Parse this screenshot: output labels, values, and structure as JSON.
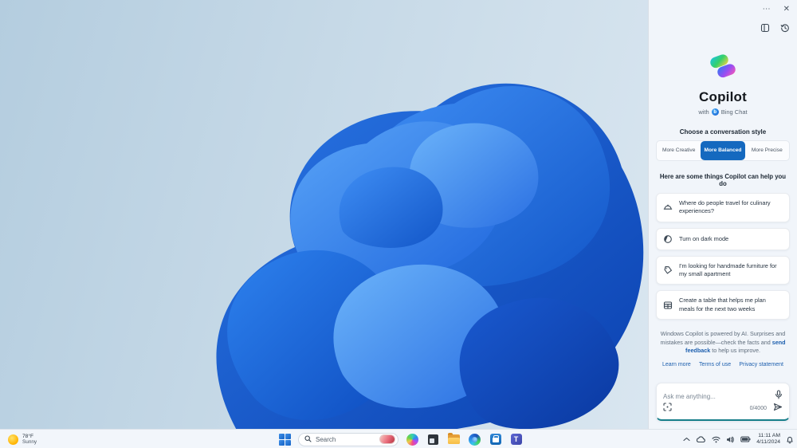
{
  "colors": {
    "accent_blue": "#1569bf",
    "link_blue": "#1d5fae",
    "input_underline_teal": "#177e8a",
    "panel_background": "#f1f5fa"
  },
  "copilot": {
    "window_controls": {
      "more": "⋯",
      "close": "✕"
    },
    "toolbar_icons": [
      "notebook-icon",
      "history-icon"
    ],
    "title": "Copilot",
    "subtitle_prefix": "with",
    "bing_badge_letter": "b",
    "subtitle_brand": "Bing Chat",
    "style_heading": "Choose a conversation style",
    "styles": [
      {
        "label": "More Creative",
        "selected": false
      },
      {
        "label": "More Balanced",
        "selected": true
      },
      {
        "label": "More Precise",
        "selected": false
      }
    ],
    "suggestions_heading": "Here are some things Copilot can help you do",
    "suggestions": [
      {
        "icon": "cloche-icon",
        "text": "Where do people travel for culinary experiences?"
      },
      {
        "icon": "dark-mode-icon",
        "text": "Turn on dark mode"
      },
      {
        "icon": "tag-icon",
        "text": "I'm looking for handmade furniture for my small apartment"
      },
      {
        "icon": "table-icon",
        "text": "Create a table that helps me plan meals for the next two weeks"
      }
    ],
    "disclaimer": {
      "part1": "Windows Copilot is powered by AI. Surprises and mistakes are possible—check the facts and ",
      "link": "send feedback",
      "part2": " to help us improve."
    },
    "footer_links": [
      "Learn more",
      "Terms of use",
      "Privacy statement"
    ],
    "input": {
      "placeholder": "Ask me anything...",
      "counter": "0/4000"
    }
  },
  "taskbar": {
    "weather": {
      "temperature": "78°F",
      "condition": "Sunny"
    },
    "search_label": "Search",
    "app_icons": [
      "start",
      "copilot",
      "task-view",
      "file-explorer",
      "edge",
      "microsoft-store",
      "teams"
    ],
    "tray_icons": [
      "chevron-up-icon",
      "onedrive-cloud-icon",
      "wifi-icon",
      "volume-icon",
      "battery-icon",
      "notifications-bell-icon"
    ],
    "clock": {
      "time": "11:11 AM",
      "date": "4/11/2024"
    }
  }
}
